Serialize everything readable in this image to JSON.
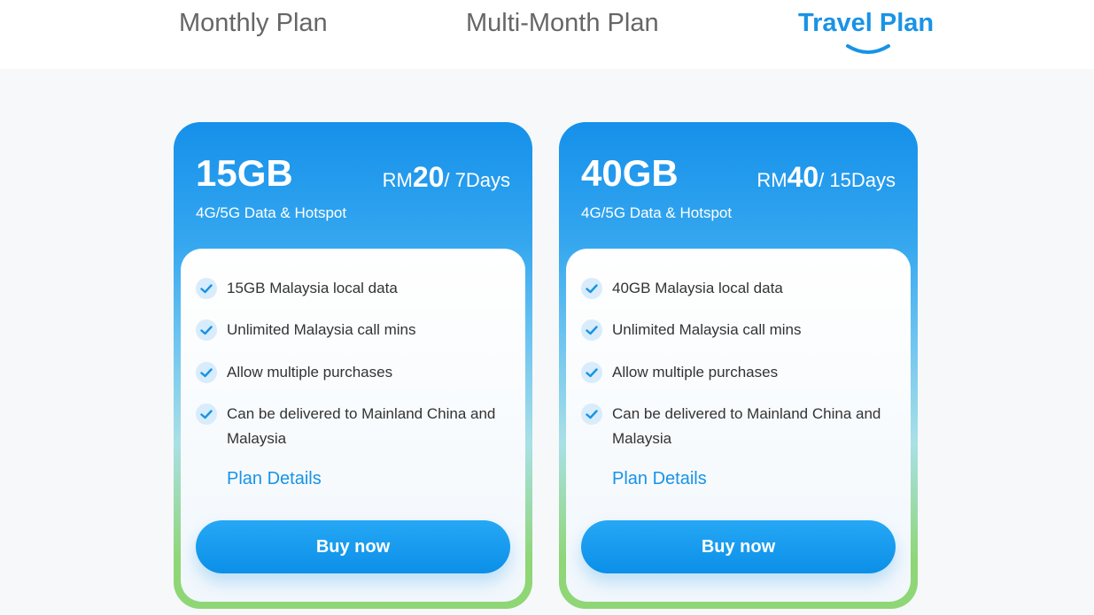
{
  "tabs": [
    {
      "label": "Monthly Plan",
      "active": false
    },
    {
      "label": "Multi-Month Plan",
      "active": false
    },
    {
      "label": "Travel Plan",
      "active": true
    }
  ],
  "colors": {
    "accent": "#1893e6",
    "check_bg": "#d8ecfb",
    "card_top": "#1590ea",
    "card_bottom": "#8fd676"
  },
  "plans": [
    {
      "data": "15GB",
      "currency": "RM",
      "amount": "20",
      "period": "/ 7Days",
      "subtitle": "4G/5G Data & Hotspot",
      "features": [
        "15GB Malaysia local data",
        "Unlimited Malaysia call mins",
        "Allow multiple purchases",
        "Can be delivered to Mainland China and Malaysia"
      ],
      "details_label": "Plan Details",
      "buy_label": "Buy now"
    },
    {
      "data": "40GB",
      "currency": "RM",
      "amount": "40",
      "period": "/ 15Days",
      "subtitle": "4G/5G Data & Hotspot",
      "features": [
        "40GB Malaysia local data",
        "Unlimited Malaysia call mins",
        "Allow multiple purchases",
        "Can be delivered to Mainland China and Malaysia"
      ],
      "details_label": "Plan Details",
      "buy_label": "Buy now"
    }
  ]
}
